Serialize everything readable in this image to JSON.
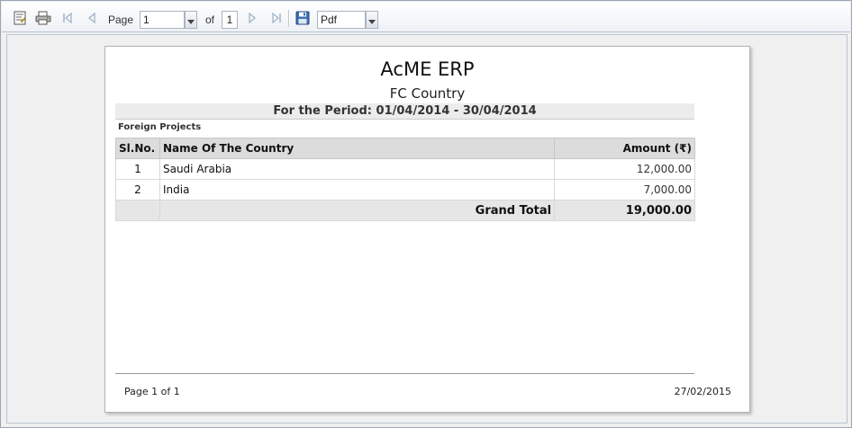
{
  "toolbar": {
    "page_label": "Page",
    "current_page": "1",
    "of_label": "of",
    "total_pages": "1",
    "export_format": "Pdf",
    "icons": [
      "document-map-icon",
      "print-icon",
      "first-page-icon",
      "prev-page-icon",
      "next-page-icon",
      "last-page-icon",
      "save-icon"
    ]
  },
  "report": {
    "title": "AcME ERP",
    "subtitle": "FC Country",
    "period": "For the Period: 01/04/2014 - 30/04/2014",
    "section": "Foreign Projects",
    "columns": [
      "Sl.No.",
      "Name Of The Country",
      "Amount (₹)"
    ],
    "rows": [
      {
        "sl": "1",
        "country": "Saudi Arabia",
        "amount": "12,000.00"
      },
      {
        "sl": "2",
        "country": "India",
        "amount": "7,000.00"
      }
    ],
    "grand_total_label": "Grand Total",
    "grand_total": "19,000.00",
    "footer_page": "Page 1 of 1",
    "footer_date": "27/02/2015"
  }
}
